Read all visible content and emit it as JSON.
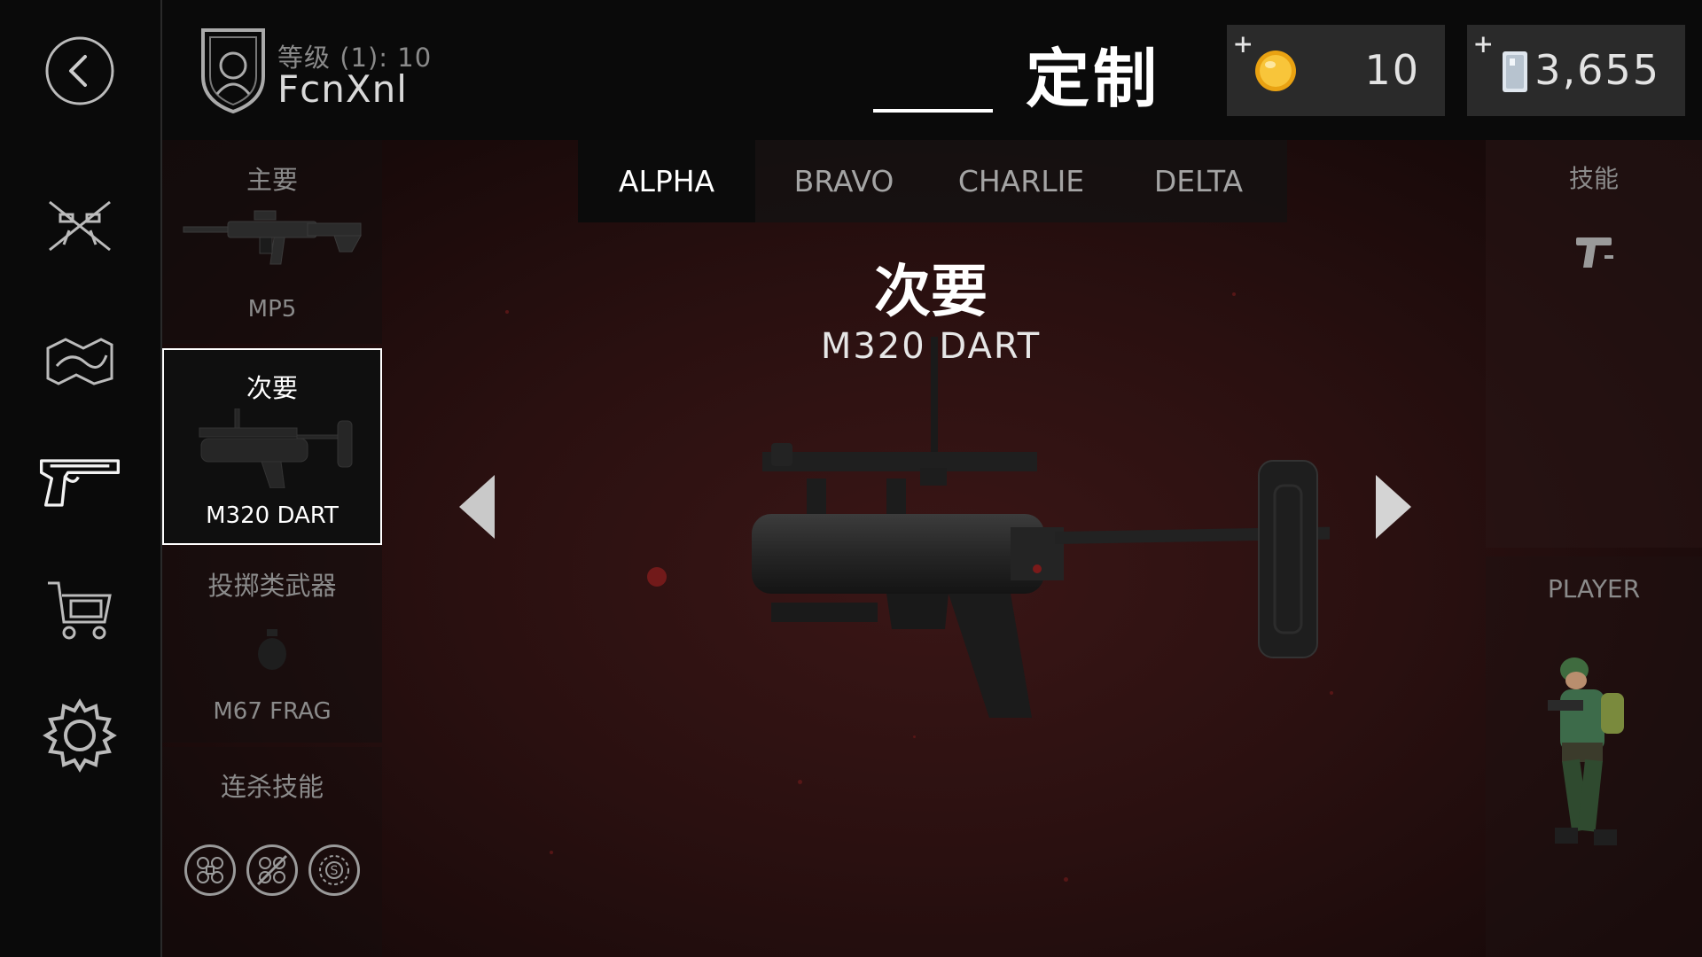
{
  "header": {
    "rank_text": "等级 (1): 10",
    "player_name": "FcnXnl",
    "page_title": "定制"
  },
  "currency": {
    "coins": {
      "plus": "+",
      "amount": "10",
      "icon": "gold-coin-icon"
    },
    "credits": {
      "plus": "+",
      "amount": "3,655",
      "icon": "credit-card-icon"
    }
  },
  "nav": {
    "items": [
      "back-arrow-icon",
      "crossed-rifles-icon",
      "camo-map-icon",
      "pistol-icon",
      "shopping-cart-icon",
      "gear-icon"
    ]
  },
  "loadout": {
    "primary": {
      "label": "主要",
      "weapon": "MP5"
    },
    "secondary": {
      "label": "次要",
      "weapon": "M320 DART"
    },
    "throwable": {
      "label": "投掷类武器",
      "weapon": "M67 FRAG"
    },
    "killstreak": {
      "label": "连杀技能"
    }
  },
  "tabs": [
    "ALPHA",
    "BRAVO",
    "CHARLIE",
    "DELTA"
  ],
  "active_tab": "ALPHA",
  "main": {
    "category_title": "次要",
    "weapon_name": "M320 DART"
  },
  "right": {
    "skills_label": "技能",
    "player_label": "PLAYER"
  },
  "colors": {
    "background": "#2a1010",
    "panel": "#0a0a0a",
    "currency_box": "#2a2a2a",
    "coin": "#f2b01e",
    "accent_white": "#ffffff"
  }
}
